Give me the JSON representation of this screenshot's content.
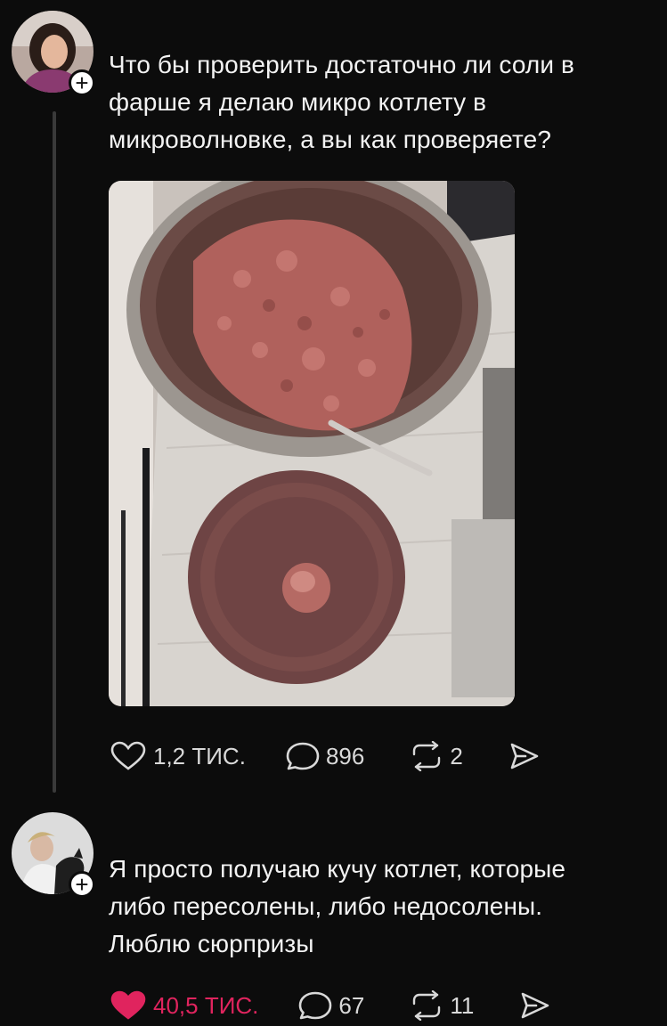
{
  "posts": [
    {
      "text": "Что бы проверить достаточно ли соли в\nфарше я делаю микро котлету в\nмикроволновке, а вы как проверяете?",
      "likes": "1,2 ТИС.",
      "comments": "896",
      "reposts": "2",
      "liked": false
    },
    {
      "text": "Я просто получаю кучу котлет, которые\nлибо пересолены, либо недосолены.\nЛюблю сюрпризы",
      "likes": "40,5 ТИС.",
      "comments": "67",
      "reposts": "11",
      "liked": true
    }
  ],
  "colors": {
    "background": "#0c0c0c",
    "text": "#f3f3f3",
    "liked": "#e0245e",
    "icon": "#d9d9d9"
  },
  "icons": [
    "follow-plus-icon",
    "heart-icon",
    "comment-icon",
    "repost-icon",
    "share-icon"
  ]
}
